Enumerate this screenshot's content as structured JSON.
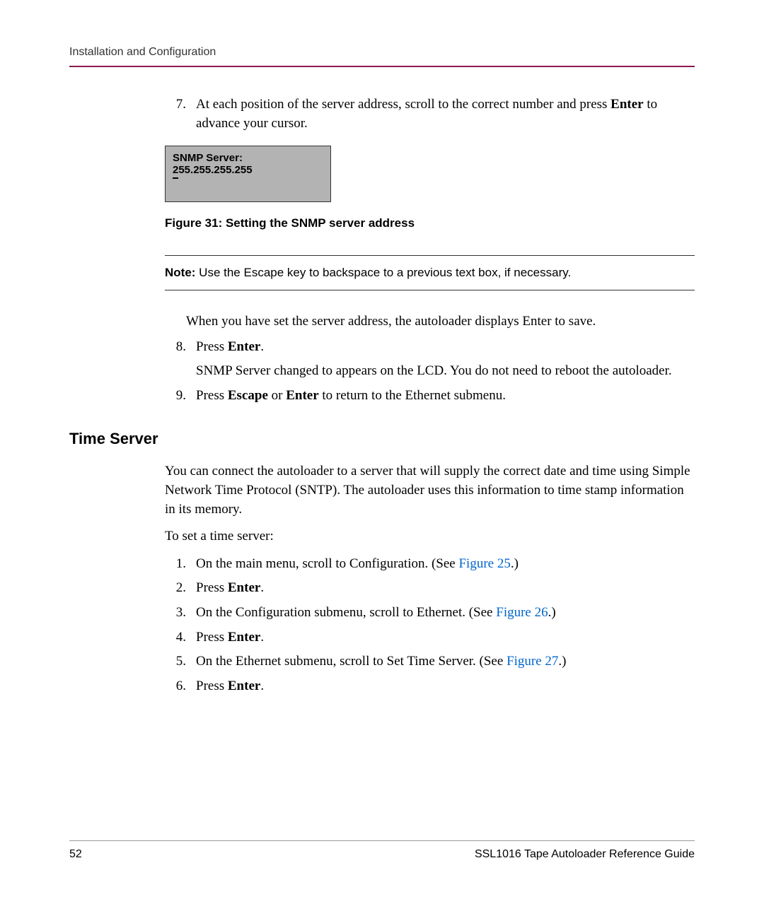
{
  "header": {
    "running_title": "Installation and Configuration"
  },
  "steps_a": [
    {
      "num": "7.",
      "prefix": "At each position of the server address, scroll to the correct number and press ",
      "bold": "Enter",
      "suffix": " to advance your cursor."
    }
  ],
  "lcd": {
    "line1": "SNMP Server:",
    "line2": "255.255.255.255"
  },
  "figure_caption": "Figure 31:  Setting the SNMP server address",
  "note": {
    "label": "Note:",
    "text": "  Use the Escape key to backspace to a previous text box, if necessary."
  },
  "para_after_note": "When you have set the server address, the autoloader displays Enter to save.",
  "steps_b": [
    {
      "num": "8.",
      "parts": [
        {
          "t": "Press ",
          "b": false
        },
        {
          "t": "Enter",
          "b": true
        },
        {
          "t": ".",
          "b": false
        }
      ],
      "continuation": "SNMP Server changed to appears on the LCD. You do not need to reboot the autoloader."
    },
    {
      "num": "9.",
      "parts": [
        {
          "t": "Press ",
          "b": false
        },
        {
          "t": "Escape",
          "b": true
        },
        {
          "t": " or ",
          "b": false
        },
        {
          "t": "Enter",
          "b": true
        },
        {
          "t": " to return to the Ethernet submenu.",
          "b": false
        }
      ]
    }
  ],
  "section_heading": "Time Server",
  "section_para": "You can connect the autoloader to a server that will supply the correct date and time using Simple Network Time Protocol (SNTP). The autoloader uses this information to time stamp information in its memory.",
  "section_intro": "To set a time server:",
  "steps_c": [
    {
      "num": "1.",
      "parts": [
        {
          "t": "On the main menu, scroll to Configuration. (See "
        },
        {
          "t": "Figure 25",
          "xref": true
        },
        {
          "t": ".)"
        }
      ]
    },
    {
      "num": "2.",
      "parts": [
        {
          "t": "Press "
        },
        {
          "t": "Enter",
          "b": true
        },
        {
          "t": "."
        }
      ]
    },
    {
      "num": "3.",
      "parts": [
        {
          "t": "On the Configuration submenu, scroll to Ethernet. (See "
        },
        {
          "t": "Figure 26",
          "xref": true
        },
        {
          "t": ".)"
        }
      ]
    },
    {
      "num": "4.",
      "parts": [
        {
          "t": "Press "
        },
        {
          "t": "Enter",
          "b": true
        },
        {
          "t": "."
        }
      ]
    },
    {
      "num": "5.",
      "parts": [
        {
          "t": "On the Ethernet submenu, scroll to Set Time Server. (See "
        },
        {
          "t": "Figure 27",
          "xref": true
        },
        {
          "t": ".)"
        }
      ]
    },
    {
      "num": "6.",
      "parts": [
        {
          "t": "Press "
        },
        {
          "t": "Enter",
          "b": true
        },
        {
          "t": "."
        }
      ]
    }
  ],
  "footer": {
    "page_number": "52",
    "doc_title": "SSL1016 Tape Autoloader Reference Guide"
  }
}
